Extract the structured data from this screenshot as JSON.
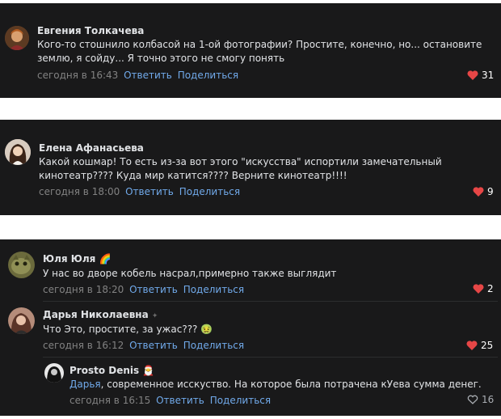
{
  "comments": [
    {
      "author": "Евгения Толкачева",
      "text_lines": [
        "Кого-то стошнило колбасой на 1-ой фотографии? Простите, конечно, но... остановите",
        "землю, я сойду... Я точно этого не смогу понять"
      ],
      "time": "сегодня в 16:43",
      "reply": "Ответить",
      "share": "Поделиться",
      "likes": "31"
    },
    {
      "author": "Елена Афанасьева",
      "text_lines": [
        "Какой кошмар! То есть из-за вот этого \"искусства\" испортили замечательный",
        "кинотеатр???? Куда мир катится???? Верните кинотеатр!!!!"
      ],
      "time": "сегодня в 18:00",
      "reply": "Ответить",
      "share": "Поделиться",
      "likes": "9"
    },
    {
      "author": "Юля Юля",
      "author_emoji": "🌈",
      "text": "У нас во дворе кобель насрал,примерно также выглядит",
      "time": "сегодня в 18:20",
      "reply": "Ответить",
      "share": "Поделиться",
      "likes": "2"
    },
    {
      "author": "Дарья Николаевна",
      "author_emoji": "✦",
      "text": "Что Это, простите, за ужас???",
      "text_emoji": "🤢",
      "time": "сегодня в 16:12",
      "reply": "Ответить",
      "share": "Поделиться",
      "likes": "25"
    },
    {
      "author": "Prosto Denis",
      "author_emoji": "🎅",
      "mention": "Дарья",
      "text": ", современное исскуство. На которое была потрачена кУева сумма денег.",
      "time": "сегодня в 16:15",
      "reply": "Ответить",
      "share": "Поделиться",
      "likes": "16"
    }
  ],
  "colors": {
    "panel_bg": "#19191a",
    "name": "#e1e3e6",
    "meta": "#828282",
    "link": "#71aaeb",
    "heart": "#e64646"
  }
}
